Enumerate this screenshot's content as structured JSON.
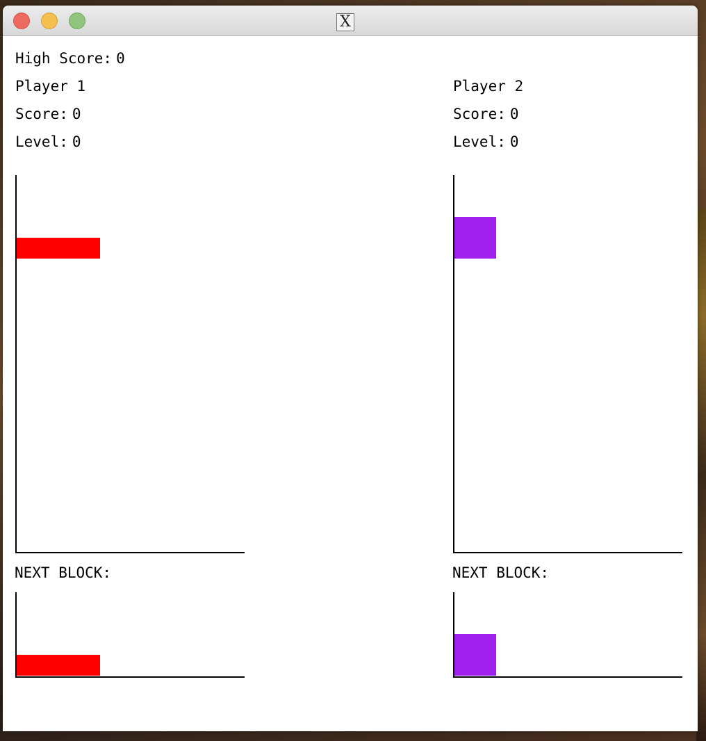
{
  "window": {
    "title_icon": "X",
    "buttons": [
      "close",
      "minimize",
      "zoom"
    ]
  },
  "high_score": {
    "label": "High Score:",
    "value": "0"
  },
  "next_block_label": "NEXT BLOCK:",
  "players": [
    {
      "name": "Player 1",
      "score_label": "Score:",
      "score": "0",
      "level_label": "Level:",
      "level": "0",
      "piece_color": "#ff0000",
      "piece_shape": "horizontal-bar"
    },
    {
      "name": "Player 2",
      "score_label": "Score:",
      "score": "0",
      "level_label": "Level:",
      "level": "0",
      "piece_color": "#a020f0",
      "piece_shape": "square"
    }
  ],
  "colors": {
    "player1_piece": "#ff0000",
    "player2_piece": "#a020f0",
    "background": "#ffffff",
    "board_lines": "#000000"
  }
}
